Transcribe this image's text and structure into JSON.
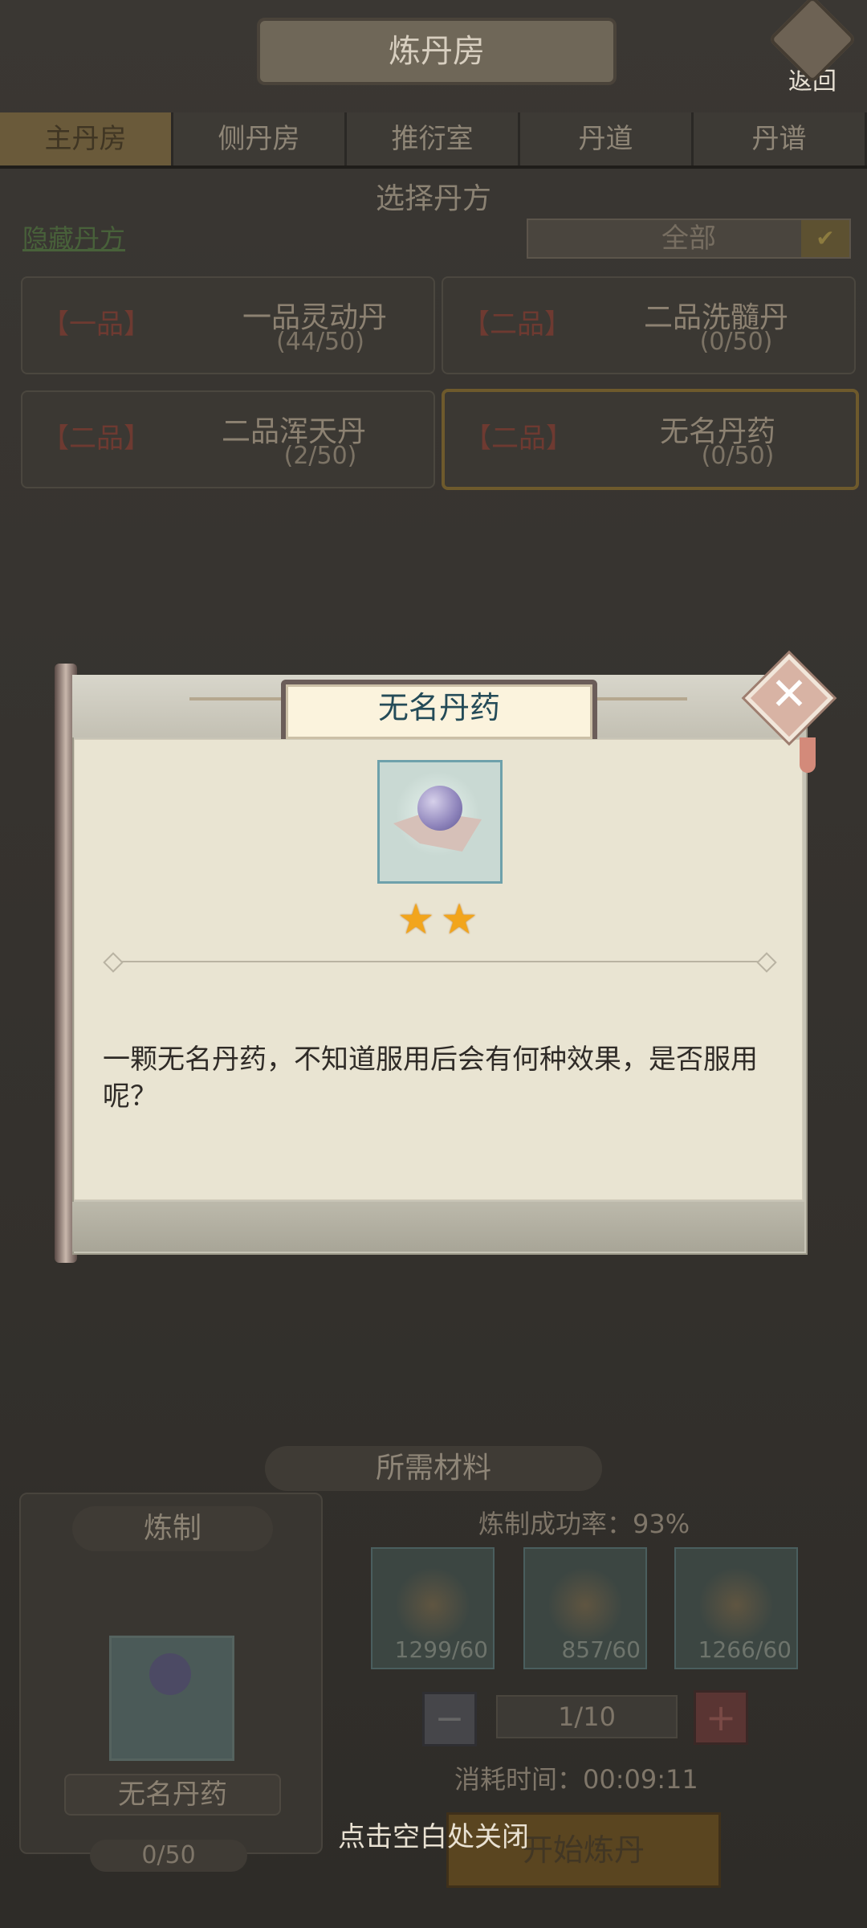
{
  "header": {
    "title": "炼丹房",
    "back_label": "返回"
  },
  "tabs": [
    {
      "label": "主丹房",
      "active": true
    },
    {
      "label": "侧丹房",
      "active": false
    },
    {
      "label": "推衍室",
      "active": false
    },
    {
      "label": "丹道",
      "active": false
    },
    {
      "label": "丹谱",
      "active": false
    }
  ],
  "select": {
    "title": "选择丹方",
    "hide_link": "隐藏丹方",
    "filter_value": "全部"
  },
  "recipes": [
    {
      "grade": "【一品】",
      "name": "一品灵动丹",
      "count": "(44/50)"
    },
    {
      "grade": "【二品】",
      "name": "二品洗髓丹",
      "count": "(0/50)"
    },
    {
      "grade": "【二品】",
      "name": "二品浑天丹",
      "count": "(2/50)"
    },
    {
      "grade": "【二品】",
      "name": "无名丹药",
      "count": "(0/50)"
    }
  ],
  "materials": {
    "title": "所需材料",
    "refine_label": "炼制",
    "product_name": "无名丹药",
    "product_progress": "0/50",
    "success_rate": "炼制成功率：93%",
    "slots": [
      {
        "count": "1299/60",
        "icon": "ginseng-icon"
      },
      {
        "count": "857/60",
        "icon": "root-icon"
      },
      {
        "count": "1266/60",
        "icon": "herb-icon"
      }
    ],
    "quantity": "1/10",
    "time": "消耗时间：00:09:11",
    "start_button": "开始炼丹"
  },
  "modal": {
    "title": "无名丹药",
    "stars": 2,
    "star_glyph": "★",
    "description": "一颗无名丹药，不知道服用后会有何种效果，是否服用呢？",
    "close_hint": "点击空白处关闭"
  },
  "colors": {
    "overlay": "#2f2d2a",
    "modal_body": "#e9e4d2",
    "title_text": "#244b58",
    "star": "#f2a51c"
  }
}
